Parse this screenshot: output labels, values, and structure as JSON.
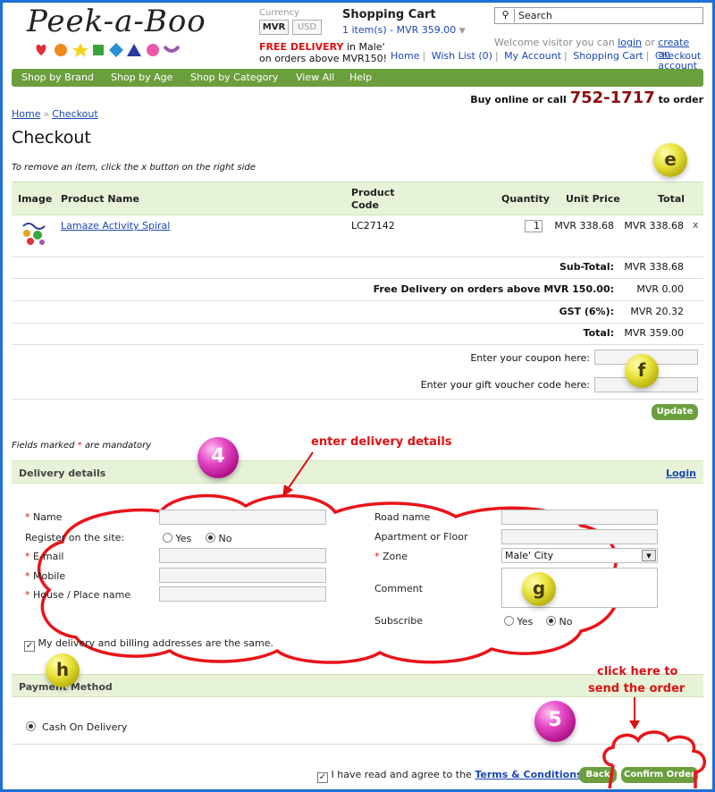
{
  "logo": {
    "text": "Peek-a-Boo"
  },
  "currency": {
    "label": "Currency",
    "options": [
      "MVR",
      "USD"
    ]
  },
  "promo": {
    "free_delivery": "FREE DELIVERY",
    "line1_rest": "in Male'",
    "line2": "on orders above MVR150!"
  },
  "cart": {
    "title": "Shopping Cart",
    "summary": "1 item(s) - MVR 359.00"
  },
  "search": {
    "placeholder": "Search"
  },
  "welcome": {
    "text": "Welcome visitor you can",
    "login": "login",
    "or": "or",
    "create": "create an account"
  },
  "toplinks": [
    "Home",
    "Wish List (0)",
    "My Account",
    "Shopping Cart",
    "Checkout"
  ],
  "nav": [
    "Shop by Brand",
    "Shop by Age",
    "Shop by Category",
    "View All",
    "Help"
  ],
  "callus": {
    "prefix": "Buy online or call",
    "phone": "752-1717",
    "suffix": "to order"
  },
  "breadcrumb": [
    "Home",
    "Checkout"
  ],
  "page": {
    "title": "Checkout",
    "hint": "To remove an item, click the x button on the right side"
  },
  "table": {
    "headers": {
      "image": "Image",
      "name": "Product Name",
      "code_line1": "Product",
      "code_line2": "Code",
      "qty": "Quantity",
      "unit": "Unit Price",
      "total": "Total"
    },
    "rows": [
      {
        "name": "Lamaze Activity Spiral",
        "code": "LC27142",
        "qty": "1",
        "unit": "MVR 338.68",
        "total": "MVR 338.68",
        "remove": "x"
      }
    ]
  },
  "totals": [
    {
      "label": "Sub-Total:",
      "value": "MVR 338.68"
    },
    {
      "label": "Free Delivery on orders above MVR 150.00:",
      "value": "MVR 0.00"
    },
    {
      "label": "GST (6%):",
      "value": "MVR 20.32"
    },
    {
      "label": "Total:",
      "value": "MVR 359.00"
    }
  ],
  "coupon": {
    "label": "Enter your coupon here:",
    "voucher_label": "Enter your gift voucher code here:",
    "update": "Update"
  },
  "mandatory": {
    "prefix": "Fields marked",
    "star": "*",
    "suffix": "are mandatory"
  },
  "delivery": {
    "title": "Delivery details",
    "login": "Login",
    "name": "Name",
    "register": "Register on the site:",
    "yes": "Yes",
    "no": "No",
    "email": "E-mail",
    "mobile": "Mobile",
    "house": "House / Place name",
    "road": "Road name",
    "apartment": "Apartment or Floor",
    "zone": "Zone",
    "zone_value": "Male' City",
    "comment": "Comment",
    "subscribe": "Subscribe",
    "same_address": "My delivery and billing addresses are the same."
  },
  "payment": {
    "title": "Payment Method",
    "option": "Cash On Delivery"
  },
  "agree": {
    "text": "I have read and agree to the",
    "terms": "Terms & Conditions",
    "back": "Back",
    "confirm": "Confirm Order"
  },
  "annotations": {
    "enter_delivery": "enter delivery details",
    "click_here_1": "click here to",
    "click_here_2": "send the order",
    "step4": "4",
    "step5": "5",
    "e": "e",
    "f": "f",
    "g": "g",
    "h": "h"
  },
  "colors": {
    "nav_green": "#6b9f3e",
    "header_green": "#e7f3d8",
    "annotation_red": "#e01010",
    "frame_blue": "#1f6fd6",
    "phone_red": "#8b0f0f"
  }
}
